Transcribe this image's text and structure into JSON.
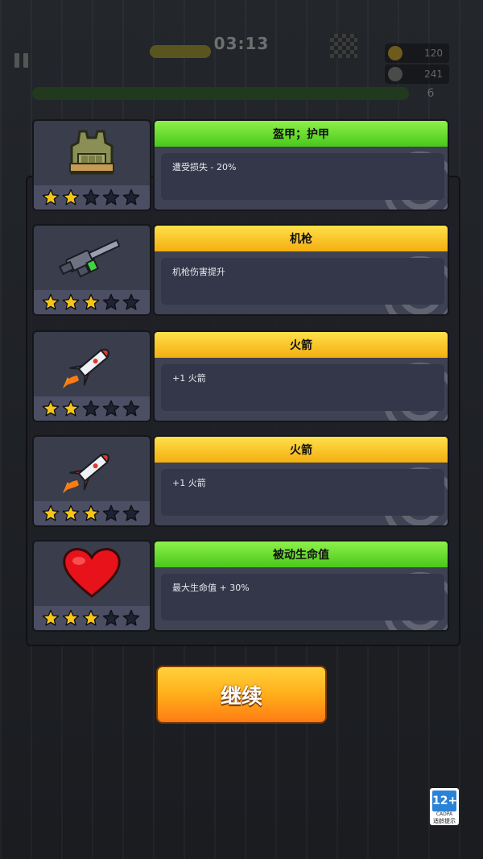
{
  "hud": {
    "timer": "03:13",
    "kills": "120",
    "coins": "241",
    "level": "6"
  },
  "cards": [
    {
      "title": "盔甲；护甲",
      "ribbon": "green",
      "icon": "armor-vest-icon",
      "stars": 2,
      "desc": "遭受损失 - 20%"
    },
    {
      "title": "机枪",
      "ribbon": "yellow",
      "icon": "machine-gun-icon",
      "stars": 3,
      "desc": "机枪伤害提升"
    },
    {
      "title": "火箭",
      "ribbon": "yellow",
      "icon": "rocket-icon",
      "stars": 2,
      "desc": "+1 火箭"
    },
    {
      "title": "火箭",
      "ribbon": "yellow",
      "icon": "rocket-icon",
      "stars": 3,
      "desc": "+1 火箭"
    },
    {
      "title": "被动生命值",
      "ribbon": "green",
      "icon": "heart-icon",
      "stars": 3,
      "desc": "最大生命值 + 30%"
    }
  ],
  "max_stars": 5,
  "continue_label": "继续",
  "age_rating": {
    "number": "12+",
    "org": "CADPA",
    "label": "适龄提示"
  },
  "colors": {
    "star_filled": "#f5c518",
    "star_empty": "#1e2232",
    "ribbon_green": "#5bd62a",
    "ribbon_yellow": "#f8c21c",
    "button": "#ffa41f"
  }
}
